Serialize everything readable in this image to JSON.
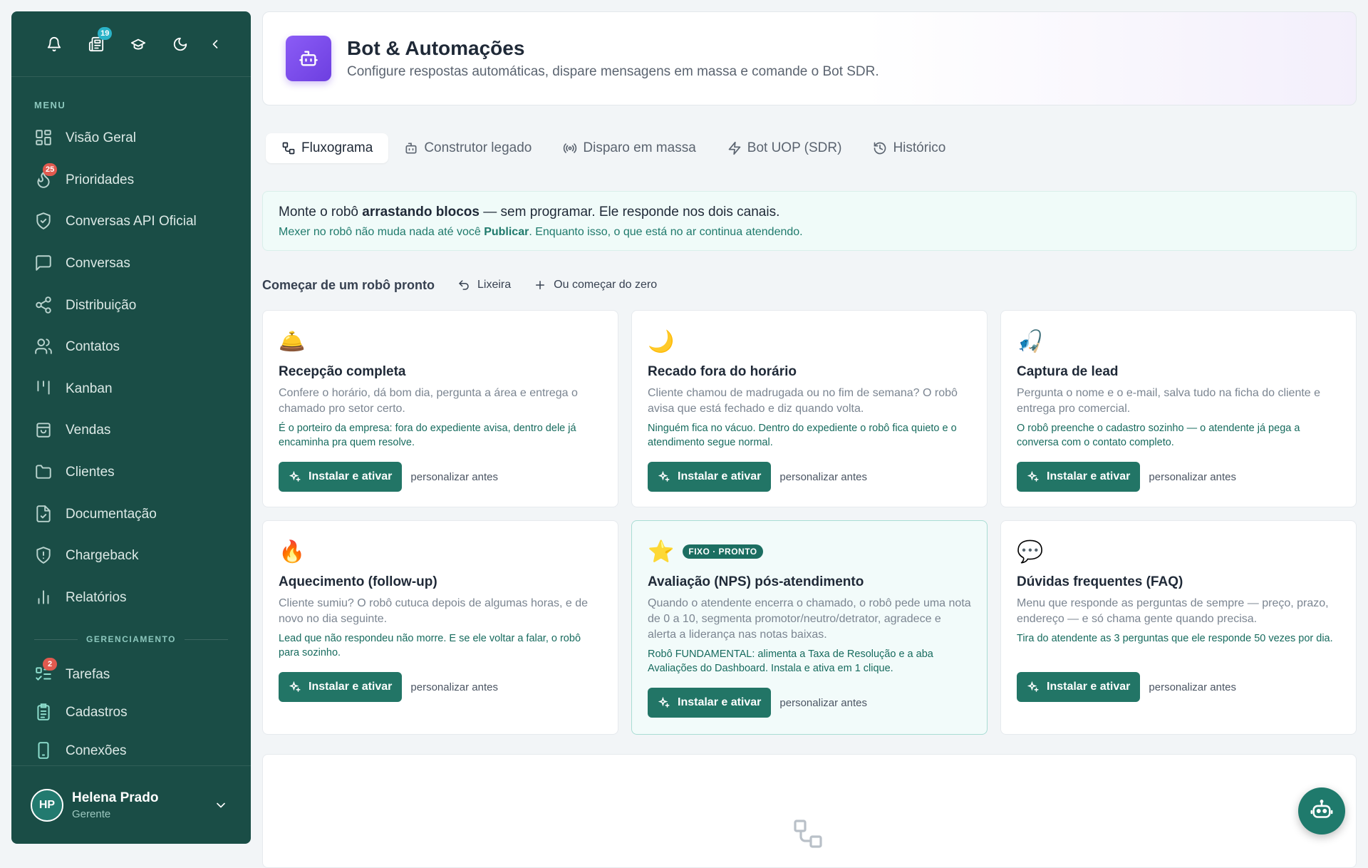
{
  "sidebar": {
    "notification_badge": "19",
    "menu_label": "MENU",
    "items": [
      {
        "label": "Visão Geral",
        "icon": "grid-icon"
      },
      {
        "label": "Prioridades",
        "icon": "fire-icon",
        "badge": "25"
      },
      {
        "label": "Conversas API Oficial",
        "icon": "shield-check-icon"
      },
      {
        "label": "Conversas",
        "icon": "chat-icon"
      },
      {
        "label": "Distribuição",
        "icon": "share-icon"
      },
      {
        "label": "Contatos",
        "icon": "users-icon"
      },
      {
        "label": "Kanban",
        "icon": "kanban-icon"
      },
      {
        "label": "Vendas",
        "icon": "bag-icon"
      },
      {
        "label": "Clientes",
        "icon": "folder-icon"
      },
      {
        "label": "Documentação",
        "icon": "document-icon"
      },
      {
        "label": "Chargeback",
        "icon": "shield-alert-icon"
      },
      {
        "label": "Relatórios",
        "icon": "bar-chart-icon"
      }
    ],
    "section2_label": "GERENCIAMENTO",
    "items2": [
      {
        "label": "Tarefas",
        "icon": "tasks-icon",
        "badge": "2"
      },
      {
        "label": "Cadastros",
        "icon": "clipboard-icon"
      },
      {
        "label": "Conexões",
        "icon": "phone-icon"
      }
    ],
    "user": {
      "initials": "HP",
      "name": "Helena Prado",
      "role": "Gerente"
    }
  },
  "header": {
    "title": "Bot & Automações",
    "subtitle": "Configure respostas automáticas, dispare mensagens em massa e comande o Bot SDR."
  },
  "tabs": [
    {
      "label": "Fluxograma",
      "icon": "flow-icon",
      "active": true
    },
    {
      "label": "Construtor legado",
      "icon": "bot-icon"
    },
    {
      "label": "Disparo em massa",
      "icon": "broadcast-icon"
    },
    {
      "label": "Bot UOP (SDR)",
      "icon": "lightning-icon"
    },
    {
      "label": "Histórico",
      "icon": "history-icon"
    }
  ],
  "info": {
    "line1_pre": "Monte o robô ",
    "line1_bold": "arrastando blocos",
    "line1_post": " — sem programar. Ele responde nos dois canais.",
    "line2_pre": "Mexer no robô não muda nada até você ",
    "line2_bold": "Publicar",
    "line2_post": ". Enquanto isso, o que está no ar continua atendendo."
  },
  "section": {
    "title": "Começar de um robô pronto",
    "trash_label": "Lixeira",
    "scratch_label": "Ou começar do zero"
  },
  "cards": [
    {
      "emoji": "🛎️",
      "title": "Recepção completa",
      "desc": "Confere o horário, dá bom dia, pergunta a área e entrega o chamado pro setor certo.",
      "note": "É o porteiro da empresa: fora do expediente avisa, dentro dele já encaminha pra quem resolve.",
      "install": "Instalar e ativar",
      "customize": "personalizar antes"
    },
    {
      "emoji": "🌙",
      "title": "Recado fora do horário",
      "desc": "Cliente chamou de madrugada ou no fim de semana? O robô avisa que está fechado e diz quando volta.",
      "note": "Ninguém fica no vácuo. Dentro do expediente o robô fica quieto e o atendimento segue normal.",
      "install": "Instalar e ativar",
      "customize": "personalizar antes"
    },
    {
      "emoji": "🎣",
      "title": "Captura de lead",
      "desc": "Pergunta o nome e o e-mail, salva tudo na ficha do cliente e entrega pro comercial.",
      "note": "O robô preenche o cadastro sozinho — o atendente já pega a conversa com o contato completo.",
      "install": "Instalar e ativar",
      "customize": "personalizar antes"
    },
    {
      "emoji": "🔥",
      "title": "Aquecimento (follow-up)",
      "desc": "Cliente sumiu? O robô cutuca depois de algumas horas, e de novo no dia seguinte.",
      "note": "Lead que não respondeu não morre. E se ele voltar a falar, o robô para sozinho.",
      "install": "Instalar e ativar",
      "customize": "personalizar antes"
    },
    {
      "emoji": "⭐",
      "badge": "FIXO · PRONTO",
      "title": "Avaliação (NPS) pós-atendimento",
      "desc": "Quando o atendente encerra o chamado, o robô pede uma nota de 0 a 10, segmenta promotor/neutro/detrator, agradece e alerta a liderança nas notas baixas.",
      "note": "Robô FUNDAMENTAL: alimenta a Taxa de Resolução e a aba Avaliações do Dashboard. Instala e ativa em 1 clique.",
      "install": "Instalar e ativar",
      "customize": "personalizar antes"
    },
    {
      "emoji": "💬",
      "title": "Dúvidas frequentes (FAQ)",
      "desc": "Menu que responde as perguntas de sempre — preço, prazo, endereço — e só chama gente quando precisa.",
      "note": "Tira do atendente as 3 perguntas que ele responde 50 vezes por dia.",
      "install": "Instalar e ativar",
      "customize": "personalizar antes"
    }
  ],
  "colors": {
    "sidebar": "#1a4d46",
    "accent": "#227566",
    "header_icon": "#7c4dea",
    "badge": "#2bb3c8",
    "badge_red": "#e05a4f"
  }
}
